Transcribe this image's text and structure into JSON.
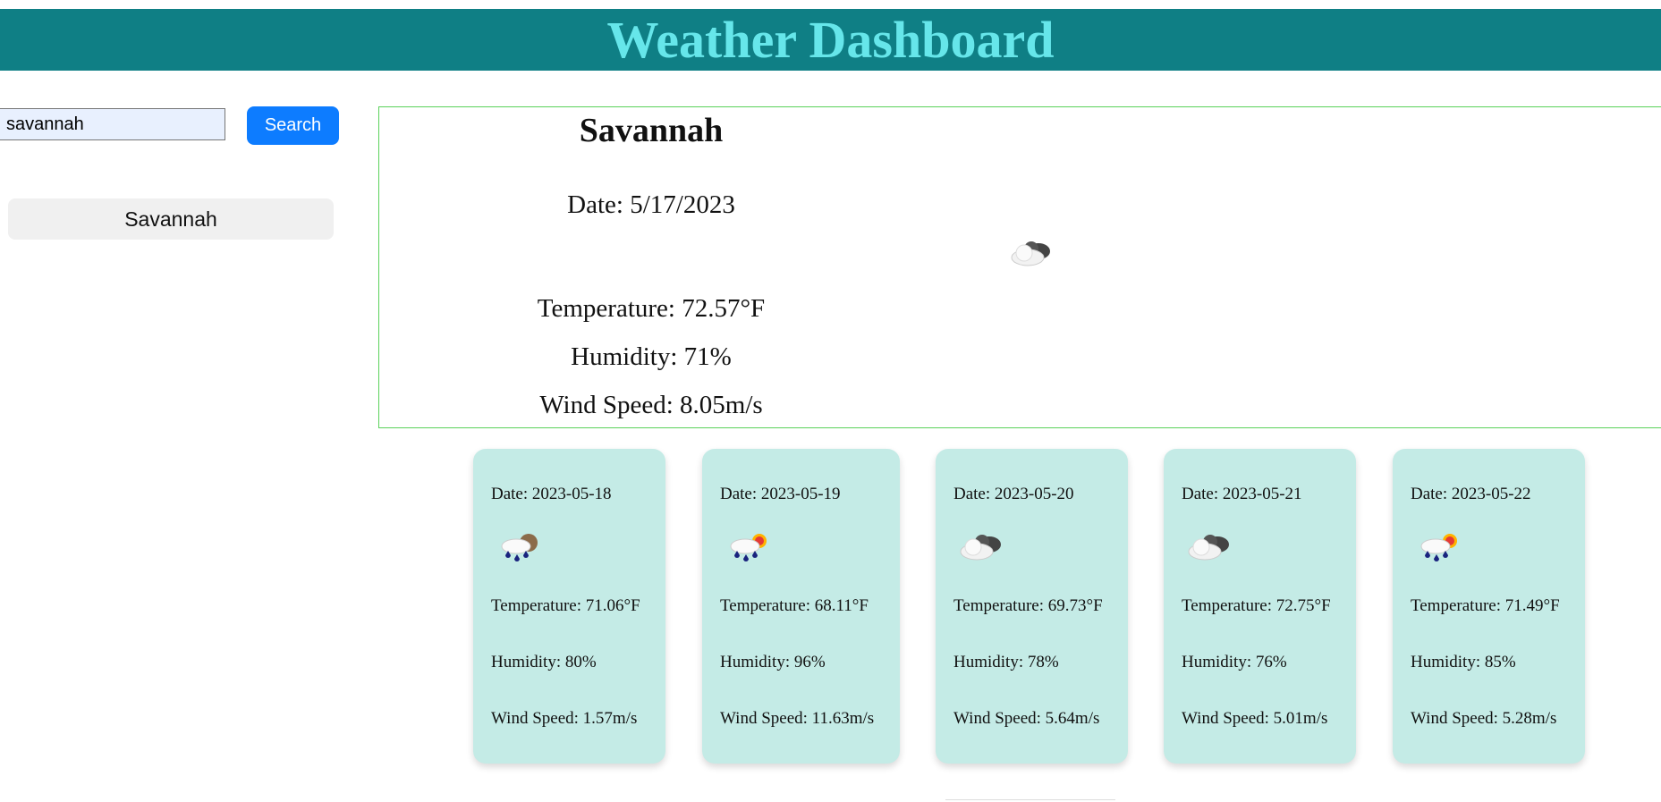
{
  "header": {
    "title": "Weather Dashboard"
  },
  "search": {
    "value": "savannah",
    "button_label": "Search"
  },
  "history": [
    "Savannah"
  ],
  "current": {
    "city": "Savannah",
    "date": "Date: 5/17/2023",
    "icon": "broken-clouds-icon",
    "temperature": "Temperature: 72.57°F",
    "humidity": "Humidity: 71%",
    "wind": "Wind Speed: 8.05m/s"
  },
  "forecast": [
    {
      "date": "Date: 2023-05-18",
      "icon": "rain-moon-icon",
      "temp": "Temperature: 71.06°F",
      "humidity": "Humidity: 80%",
      "wind": "Wind Speed: 1.57m/s"
    },
    {
      "date": "Date: 2023-05-19",
      "icon": "rain-sun-icon",
      "temp": "Temperature: 68.11°F",
      "humidity": "Humidity: 96%",
      "wind": "Wind Speed: 11.63m/s"
    },
    {
      "date": "Date: 2023-05-20",
      "icon": "broken-clouds-icon",
      "temp": "Temperature: 69.73°F",
      "humidity": "Humidity: 78%",
      "wind": "Wind Speed: 5.64m/s"
    },
    {
      "date": "Date: 2023-05-21",
      "icon": "broken-clouds-icon",
      "temp": "Temperature: 72.75°F",
      "humidity": "Humidity: 76%",
      "wind": "Wind Speed: 5.01m/s"
    },
    {
      "date": "Date: 2023-05-22",
      "icon": "rain-sun-icon",
      "temp": "Temperature: 71.49°F",
      "humidity": "Humidity: 85%",
      "wind": "Wind Speed: 5.28m/s"
    }
  ],
  "colors": {
    "header_bg": "#0f7f85",
    "header_text": "#66e6ea",
    "button": "#0d7cff",
    "card_bg": "#c4ebe6",
    "border": "#5ad25a"
  }
}
